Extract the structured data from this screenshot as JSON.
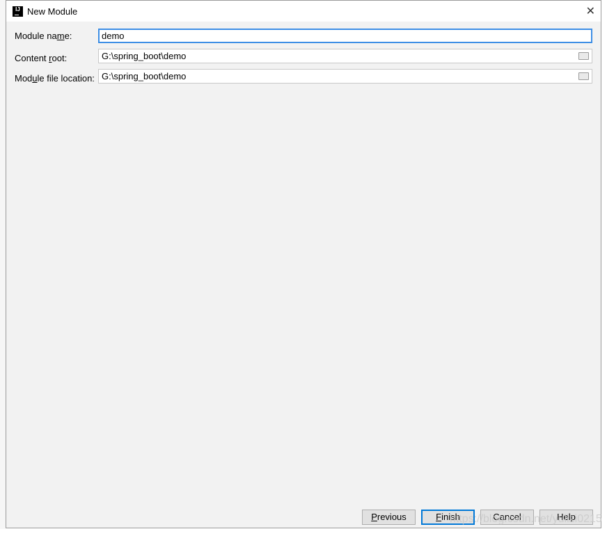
{
  "window": {
    "title": "New Module",
    "icon": "intellij-icon",
    "close_icon": "close-icon"
  },
  "form": {
    "module_name": {
      "label_pre": "Module na",
      "label_mn": "m",
      "label_post": "e:",
      "value": "demo"
    },
    "content_root": {
      "label_pre": "Content ",
      "label_mn": "r",
      "label_post": "oot:",
      "value": "G:\\spring_boot\\demo"
    },
    "module_file_location": {
      "label_pre": "Mod",
      "label_mn": "u",
      "label_post": "le file location:",
      "value": "G:\\spring_boot\\demo"
    }
  },
  "buttons": {
    "previous": {
      "mn": "P",
      "rest": "revious"
    },
    "finish": {
      "mn": "F",
      "rest": "inish"
    },
    "cancel": "Cancel",
    "help": "Help"
  },
  "watermark": "https://blog.csdn.net/yulizi0215",
  "colors": {
    "accent": "#0078d7",
    "focus": "#3d8ee5"
  }
}
